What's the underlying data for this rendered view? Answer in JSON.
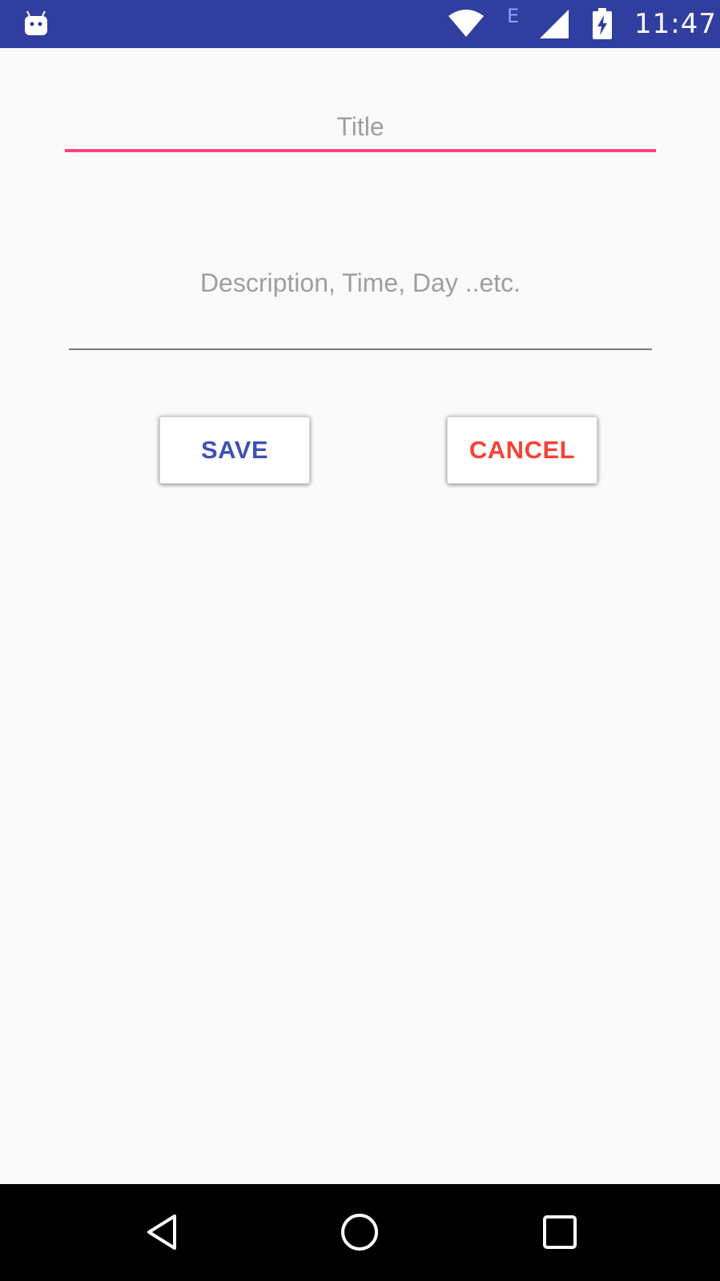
{
  "status_bar": {
    "network_type": "E",
    "time": "11:47",
    "icons": [
      "android-debug-icon",
      "wifi-icon",
      "signal-icon",
      "battery-charging-icon"
    ]
  },
  "form": {
    "title_placeholder": "Title",
    "title_value": "",
    "description_placeholder": "Description, Time, Day ..etc.",
    "description_value": "",
    "accent_color": "#ff4081"
  },
  "actions": {
    "save_label": "SAVE",
    "save_color": "#3f51b5",
    "cancel_label": "CANCEL",
    "cancel_color": "#f44336"
  },
  "nav_bar": {
    "icons": [
      "back-icon",
      "home-icon",
      "recents-icon"
    ]
  },
  "colors": {
    "status_bar": "#303f9f",
    "background": "#fafafa",
    "nav_bar": "#000000"
  }
}
